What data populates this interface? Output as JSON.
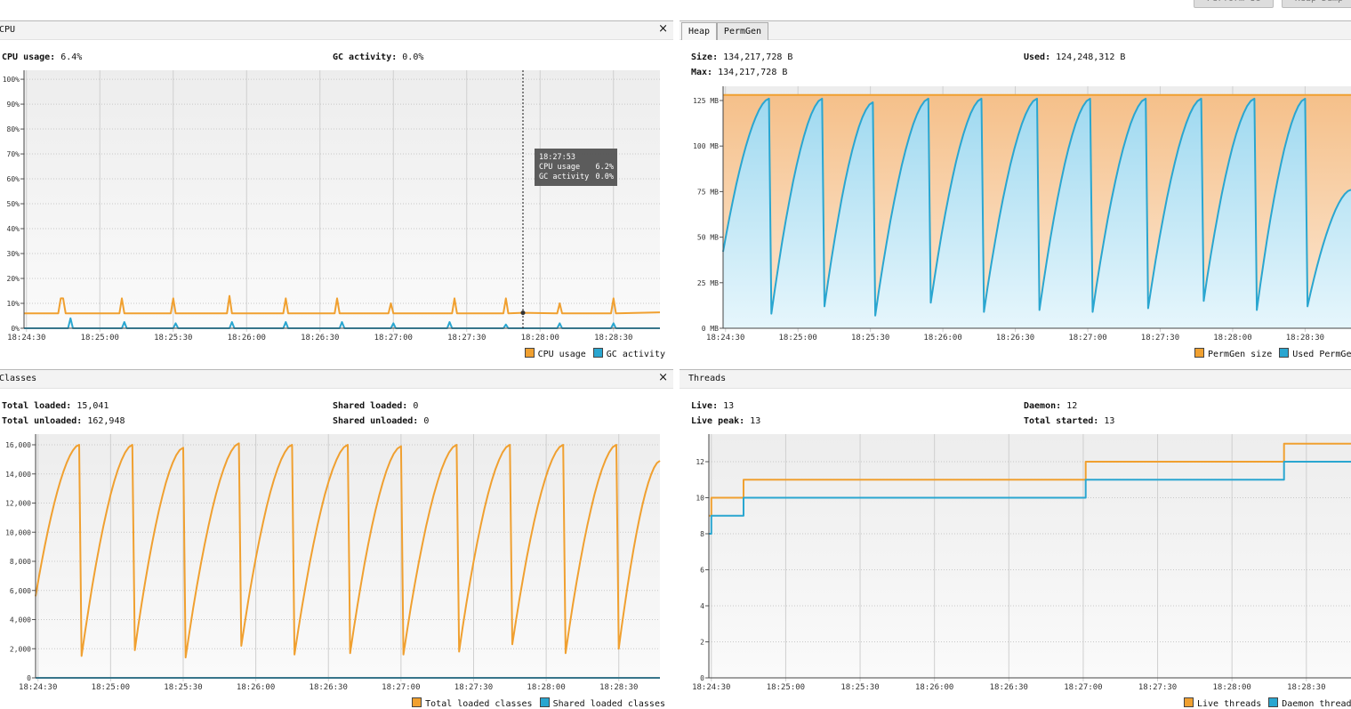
{
  "toolbar": {
    "buttons": [
      "Perform GC",
      "Heap Dump"
    ]
  },
  "colors": {
    "orange": "#f0a030",
    "blue": "#2aa6d0",
    "orange_fill": "#f6c895",
    "blue_fill": "#aee0f3"
  },
  "cpu": {
    "title": "CPU",
    "close_icon": "close-icon",
    "cpu_usage_label": "CPU usage:",
    "cpu_usage_value": "6.4%",
    "gc_activity_label": "GC activity:",
    "gc_activity_value": "0.0%",
    "tooltip": {
      "time": "18:27:53",
      "rows": [
        {
          "label": "CPU usage",
          "value": "6.2%"
        },
        {
          "label": "GC activity",
          "value": "0.0%"
        }
      ]
    },
    "legend": [
      "CPU usage",
      "GC activity"
    ]
  },
  "memory": {
    "tabs": [
      "Heap",
      "PermGen"
    ],
    "selected_tab": "PermGen",
    "size_label": "Size:",
    "size_value": "134,217,728 B",
    "max_label": "Max:",
    "max_value": "134,217,728 B",
    "used_label": "Used:",
    "used_value": "124,248,312 B",
    "legend": [
      "PermGen size",
      "Used PermGen"
    ]
  },
  "classes": {
    "title": "Classes",
    "close_icon": "close-icon",
    "total_loaded_label": "Total loaded:",
    "total_loaded_value": "15,041",
    "total_unloaded_label": "Total unloaded:",
    "total_unloaded_value": "162,948",
    "shared_loaded_label": "Shared loaded:",
    "shared_loaded_value": "0",
    "shared_unloaded_label": "Shared unloaded:",
    "shared_unloaded_value": "0",
    "legend": [
      "Total loaded classes",
      "Shared loaded classes"
    ]
  },
  "threads": {
    "title": "Threads",
    "live_label": "Live:",
    "live_value": "13",
    "live_peak_label": "Live peak:",
    "live_peak_value": "13",
    "daemon_label": "Daemon:",
    "daemon_value": "12",
    "total_started_label": "Total started:",
    "total_started_value": "13",
    "legend": [
      "Live threads",
      "Daemon threads"
    ]
  },
  "chart_data": [
    {
      "id": "cpu",
      "type": "line",
      "xlim": [
        "18:24:29",
        "18:28:49"
      ],
      "ylim": [
        0,
        103.6
      ],
      "xticks": [
        "18:24:30",
        "18:25:00",
        "18:25:30",
        "18:26:00",
        "18:26:30",
        "18:27:00",
        "18:27:30",
        "18:28:00",
        "18:28:30"
      ],
      "yticks": [
        0,
        10,
        20,
        30,
        40,
        50,
        60,
        70,
        80,
        90,
        100
      ],
      "yticklabels": [
        "0%",
        "10%",
        "20%",
        "30%",
        "40%",
        "50%",
        "60%",
        "70%",
        "80%",
        "90%",
        "100%"
      ],
      "grid": true,
      "legend_position": "bottom-right",
      "cursor_time": "18:27:53",
      "series": [
        {
          "name": "CPU usage",
          "color": "#f0a030",
          "points": [
            [
              "18:24:29",
              6
            ],
            [
              "18:24:43",
              6
            ],
            [
              "18:24:44",
              12
            ],
            [
              "18:24:45",
              12
            ],
            [
              "18:24:46",
              6
            ],
            [
              "18:25:08",
              6
            ],
            [
              "18:25:09",
              12
            ],
            [
              "18:25:10",
              6
            ],
            [
              "18:25:29",
              6
            ],
            [
              "18:25:30",
              12
            ],
            [
              "18:25:31",
              6
            ],
            [
              "18:25:52",
              6
            ],
            [
              "18:25:53",
              13
            ],
            [
              "18:25:54",
              6
            ],
            [
              "18:26:15",
              6
            ],
            [
              "18:26:16",
              12
            ],
            [
              "18:26:17",
              6
            ],
            [
              "18:26:36",
              6
            ],
            [
              "18:26:37",
              12
            ],
            [
              "18:26:38",
              6
            ],
            [
              "18:26:58",
              6
            ],
            [
              "18:26:59",
              10
            ],
            [
              "18:27:00",
              6
            ],
            [
              "18:27:24",
              6
            ],
            [
              "18:27:25",
              12
            ],
            [
              "18:27:26",
              6
            ],
            [
              "18:27:45",
              6
            ],
            [
              "18:27:46",
              12
            ],
            [
              "18:27:47",
              6
            ],
            [
              "18:27:53",
              6.2
            ],
            [
              "18:28:07",
              6
            ],
            [
              "18:28:08",
              10
            ],
            [
              "18:28:09",
              6
            ],
            [
              "18:28:29",
              6
            ],
            [
              "18:28:30",
              12
            ],
            [
              "18:28:31",
              6
            ],
            [
              "18:28:49",
              6.4
            ]
          ]
        },
        {
          "name": "GC activity",
          "color": "#2aa6d0",
          "points": [
            [
              "18:24:29",
              0
            ],
            [
              "18:24:47",
              0
            ],
            [
              "18:24:48",
              4
            ],
            [
              "18:24:49",
              0
            ],
            [
              "18:25:09",
              0
            ],
            [
              "18:25:10",
              2.5
            ],
            [
              "18:25:11",
              0
            ],
            [
              "18:25:30",
              0
            ],
            [
              "18:25:31",
              2
            ],
            [
              "18:25:32",
              0
            ],
            [
              "18:25:53",
              0
            ],
            [
              "18:25:54",
              2.5
            ],
            [
              "18:25:55",
              0
            ],
            [
              "18:26:15",
              0
            ],
            [
              "18:26:16",
              2.5
            ],
            [
              "18:26:17",
              0
            ],
            [
              "18:26:38",
              0
            ],
            [
              "18:26:39",
              2.5
            ],
            [
              "18:26:40",
              0
            ],
            [
              "18:26:59",
              0
            ],
            [
              "18:27:00",
              2
            ],
            [
              "18:27:01",
              0
            ],
            [
              "18:27:22",
              0
            ],
            [
              "18:27:23",
              2.5
            ],
            [
              "18:27:24",
              0
            ],
            [
              "18:27:45",
              0
            ],
            [
              "18:27:46",
              1.5
            ],
            [
              "18:27:47",
              0
            ],
            [
              "18:28:07",
              0
            ],
            [
              "18:28:08",
              2
            ],
            [
              "18:28:09",
              0
            ],
            [
              "18:28:29",
              0
            ],
            [
              "18:28:30",
              2
            ],
            [
              "18:28:31",
              0
            ],
            [
              "18:28:49",
              0
            ]
          ]
        }
      ]
    },
    {
      "id": "permgen",
      "type": "area",
      "xlim": [
        "18:24:29",
        "18:28:49"
      ],
      "ylim": [
        0,
        132.8
      ],
      "xticks": [
        "18:24:30",
        "18:25:00",
        "18:25:30",
        "18:26:00",
        "18:26:30",
        "18:27:00",
        "18:27:30",
        "18:28:00",
        "18:28:30"
      ],
      "yticks": [
        0,
        25,
        50,
        75,
        100,
        125
      ],
      "yticklabels": [
        "0 MB",
        "25 MB",
        "50 MB",
        "75 MB",
        "100 MB",
        "125 MB"
      ],
      "grid": true,
      "legend_position": "bottom-right",
      "series": [
        {
          "name": "PermGen size",
          "color": "#f0a030",
          "fill": "#f6c895",
          "points": [
            [
              "18:24:29",
              128
            ],
            [
              "18:28:49",
              128
            ]
          ]
        },
        {
          "name": "Used PermGen",
          "color": "#2aa6d0",
          "fill": "#aee0f3",
          "curve": "sawtooth",
          "points": [
            [
              "18:24:29",
              42
            ],
            [
              "18:24:48",
              126
            ],
            [
              "18:24:49",
              8
            ],
            [
              "18:25:10",
              126
            ],
            [
              "18:25:11",
              12
            ],
            [
              "18:25:31",
              124
            ],
            [
              "18:25:32",
              7
            ],
            [
              "18:25:54",
              126
            ],
            [
              "18:25:55",
              14
            ],
            [
              "18:26:16",
              126
            ],
            [
              "18:26:17",
              9
            ],
            [
              "18:26:39",
              126
            ],
            [
              "18:26:40",
              10
            ],
            [
              "18:27:01",
              126
            ],
            [
              "18:27:02",
              9
            ],
            [
              "18:27:24",
              126
            ],
            [
              "18:27:25",
              11
            ],
            [
              "18:27:47",
              126
            ],
            [
              "18:27:48",
              15
            ],
            [
              "18:28:09",
              126
            ],
            [
              "18:28:10",
              10
            ],
            [
              "18:28:30",
              126
            ],
            [
              "18:28:31",
              12
            ],
            [
              "18:28:49",
              76
            ]
          ]
        }
      ]
    },
    {
      "id": "classes",
      "type": "line",
      "xlim": [
        "18:24:29",
        "18:28:47"
      ],
      "ylim": [
        0,
        16733
      ],
      "xticks": [
        "18:24:30",
        "18:25:00",
        "18:25:30",
        "18:26:00",
        "18:26:30",
        "18:27:00",
        "18:27:30",
        "18:28:00",
        "18:28:30"
      ],
      "yticks": [
        0,
        2000,
        4000,
        6000,
        8000,
        10000,
        12000,
        14000,
        16000
      ],
      "yticklabels": [
        "0",
        "2,000",
        "4,000",
        "6,000",
        "8,000",
        "10,000",
        "12,000",
        "14,000",
        "16,000"
      ],
      "grid": true,
      "legend_position": "bottom-right",
      "series": [
        {
          "name": "Total loaded classes",
          "color": "#f0a030",
          "curve": "sawtooth",
          "points": [
            [
              "18:24:29",
              5600
            ],
            [
              "18:24:47",
              16000
            ],
            [
              "18:24:48",
              1500
            ],
            [
              "18:25:09",
              16000
            ],
            [
              "18:25:10",
              1900
            ],
            [
              "18:25:30",
              15800
            ],
            [
              "18:25:31",
              1400
            ],
            [
              "18:25:53",
              16100
            ],
            [
              "18:25:54",
              2200
            ],
            [
              "18:26:15",
              16000
            ],
            [
              "18:26:16",
              1600
            ],
            [
              "18:26:38",
              16000
            ],
            [
              "18:26:39",
              1700
            ],
            [
              "18:27:00",
              15900
            ],
            [
              "18:27:01",
              1600
            ],
            [
              "18:27:23",
              16000
            ],
            [
              "18:27:24",
              1800
            ],
            [
              "18:27:45",
              16000
            ],
            [
              "18:27:46",
              2300
            ],
            [
              "18:28:07",
              16000
            ],
            [
              "18:28:08",
              1700
            ],
            [
              "18:28:29",
              16000
            ],
            [
              "18:28:30",
              2000
            ],
            [
              "18:28:47",
              14900
            ]
          ]
        },
        {
          "name": "Shared loaded classes",
          "color": "#2aa6d0",
          "points": [
            [
              "18:24:29",
              0
            ],
            [
              "18:28:47",
              0
            ]
          ]
        }
      ]
    },
    {
      "id": "threads",
      "type": "line",
      "xlim": [
        "18:24:29",
        "18:28:48"
      ],
      "ylim": [
        0,
        13.53
      ],
      "xticks": [
        "18:24:30",
        "18:25:00",
        "18:25:30",
        "18:26:00",
        "18:26:30",
        "18:27:00",
        "18:27:30",
        "18:28:00",
        "18:28:30"
      ],
      "yticks": [
        0,
        2,
        4,
        6,
        8,
        10,
        12
      ],
      "yticklabels": [
        "0",
        "2",
        "4",
        "6",
        "8",
        "10",
        "12"
      ],
      "grid": true,
      "legend_position": "bottom-right",
      "series": [
        {
          "name": "Live threads",
          "color": "#f0a030",
          "curve": "step",
          "points": [
            [
              "18:24:29",
              9
            ],
            [
              "18:24:30",
              10
            ],
            [
              "18:24:43",
              11
            ],
            [
              "18:27:01",
              12
            ],
            [
              "18:28:21",
              13
            ],
            [
              "18:28:48",
              13
            ]
          ]
        },
        {
          "name": "Daemon threads",
          "color": "#2aa6d0",
          "curve": "step",
          "points": [
            [
              "18:24:29",
              8
            ],
            [
              "18:24:30",
              9
            ],
            [
              "18:24:43",
              10
            ],
            [
              "18:27:01",
              11
            ],
            [
              "18:28:21",
              12
            ],
            [
              "18:28:48",
              12
            ]
          ]
        }
      ]
    }
  ]
}
